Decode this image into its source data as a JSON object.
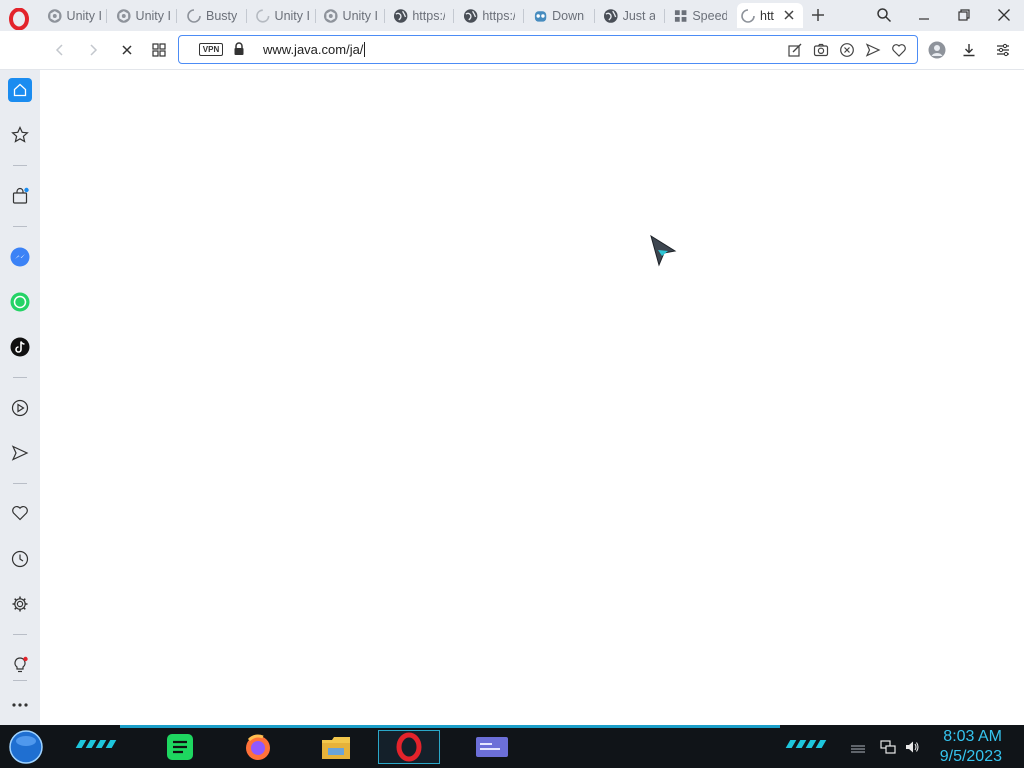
{
  "browser": {
    "tabs": [
      {
        "label": "Unity I",
        "icon": "unity-icon"
      },
      {
        "label": "Unity I",
        "icon": "unity-icon"
      },
      {
        "label": "Busty",
        "icon": "loading-spinner-icon"
      },
      {
        "label": "Unity I",
        "icon": "loading-spinner-icon"
      },
      {
        "label": "Unity I",
        "icon": "unity-icon"
      },
      {
        "label": "https:/",
        "icon": "globe-icon"
      },
      {
        "label": "https:/",
        "icon": "globe-icon"
      },
      {
        "label": "Downl",
        "icon": "godot-icon"
      },
      {
        "label": "Just a",
        "icon": "globe-icon"
      },
      {
        "label": "Speed",
        "icon": "speed-dial-icon"
      },
      {
        "label": "htt",
        "icon": "loading-spinner-icon",
        "active": true
      }
    ],
    "address_bar": {
      "vpn_label": "VPN",
      "url": "www.java.com/ja/"
    }
  },
  "taskbar": {
    "time": "8:03 AM",
    "date": "9/5/2023",
    "apps": [
      "spotify-icon",
      "firefox-icon",
      "file-explorer-icon",
      "opera-icon",
      "card-app-icon"
    ]
  },
  "colors": {
    "accent": "#4c8cf5",
    "sidebar_bg": "#e9ecf1",
    "opera_red": "#e3232b",
    "home_blue": "#1a8cf0",
    "clock_cyan": "#35c4ef"
  }
}
